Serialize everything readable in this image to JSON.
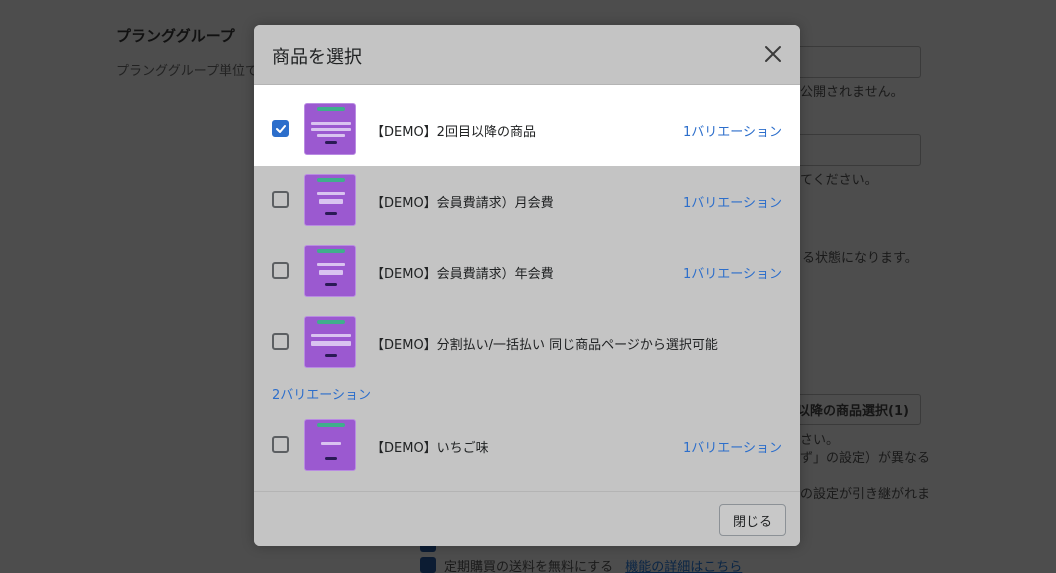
{
  "background": {
    "section_title": "プランググループ",
    "section_sub": "プランググループ単位で商品",
    "lines": [
      "公開されません。",
      "てください。",
      "る状態になります。",
      "さい。",
      "ず」の設定）が異なる",
      "の設定が引き継がれま"
    ],
    "select_button": "以降の商品選択(1)",
    "checkbox_label": "定期購買の送料を無料にする",
    "details_link": "機能の詳細はこちら"
  },
  "modal": {
    "title": "商品を選択",
    "close_label": "閉じる",
    "items": [
      {
        "name": "【DEMO】2回目以降の商品",
        "variants": "1バリエーション",
        "checked": true
      },
      {
        "name": "【DEMO】会員費請求）月会費",
        "variants": "1バリエーション",
        "checked": false
      },
      {
        "name": "【DEMO】会員費請求）年会費",
        "variants": "1バリエーション",
        "checked": false
      },
      {
        "name": "【DEMO】分割払い/一括払い 同じ商品ページから選択可能",
        "variants": "2バリエーション",
        "checked": false
      },
      {
        "name": "【DEMO】いちご味",
        "variants": "1バリエーション",
        "checked": false
      }
    ]
  },
  "colors": {
    "accent": "#2c6ecb",
    "thumbnail": "#9b59d0",
    "overlay": "#4d4d4d"
  }
}
